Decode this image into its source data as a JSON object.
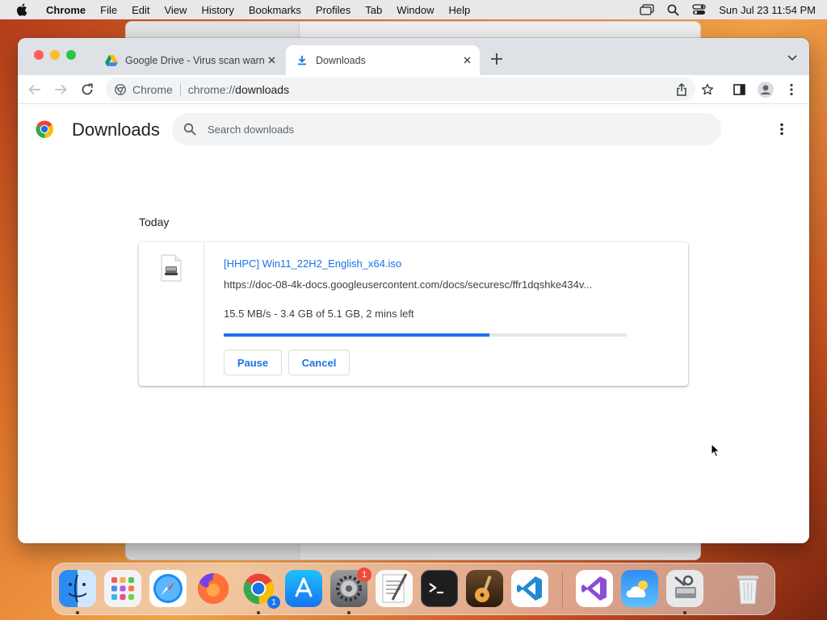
{
  "menubar": {
    "app_name": "Chrome",
    "items": [
      "File",
      "Edit",
      "View",
      "History",
      "Bookmarks",
      "Profiles",
      "Tab",
      "Window",
      "Help"
    ],
    "clock": "Sun Jul 23  11:54 PM"
  },
  "tabs": [
    {
      "title": "Google Drive - Virus scan warn",
      "favicon": "google-drive-icon"
    },
    {
      "title": "Downloads",
      "favicon": "download-icon"
    }
  ],
  "omnibox": {
    "scheme_label": "Chrome",
    "url_prefix": "chrome://",
    "url_host": "downloads"
  },
  "page": {
    "title": "Downloads",
    "search_placeholder": "Search downloads",
    "section": "Today"
  },
  "download": {
    "filename": "[HHPC] Win11_22H2_English_x64.iso",
    "url": "https://doc-08-4k-docs.googleusercontent.com/docs/securesc/ffr1dqshke434v...",
    "status": "15.5 MB/s - 3.4 GB of 5.1 GB, 2 mins left",
    "progress_fraction": 0.66,
    "pause_label": "Pause",
    "cancel_label": "Cancel"
  },
  "dock": {
    "apps": [
      "Finder",
      "Launchpad",
      "Safari",
      "Firefox",
      "Google Chrome",
      "App Store",
      "System Settings",
      "TextEdit",
      "Terminal",
      "GarageBand",
      "Visual Studio Code",
      "Visual Studio",
      "Weather",
      "Disk Utility",
      "Trash"
    ],
    "settings_badge": "1",
    "chrome_badge": "1"
  }
}
